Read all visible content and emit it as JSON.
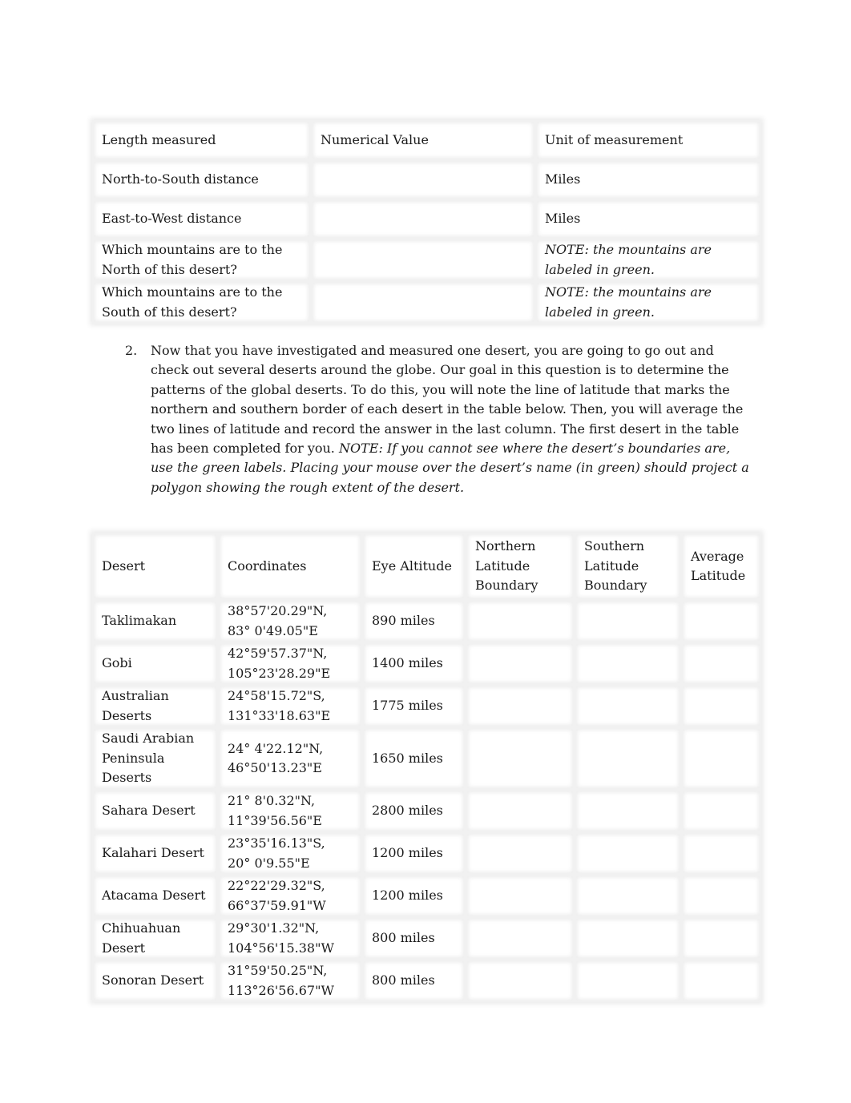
{
  "table1": {
    "headers": [
      "Length measured",
      "Numerical Value",
      "Unit of measurement"
    ],
    "rows": [
      {
        "label": "North-to-South distance",
        "value": "",
        "unit": "Miles",
        "unit_italic": false
      },
      {
        "label": "East-to-West distance",
        "value": "",
        "unit": "Miles",
        "unit_italic": false
      },
      {
        "label": "Which mountains are to the North of this desert?",
        "value": "",
        "unit": "NOTE: the mountains are labeled in green.",
        "unit_italic": true
      },
      {
        "label": "Which mountains are to the South of this desert?",
        "value": "",
        "unit": "NOTE: the mountains are labeled in green.",
        "unit_italic": true
      }
    ]
  },
  "question2": {
    "number": "2.",
    "text": "Now that you have investigated and measured one desert, you are going to go out and check out several deserts around the globe.  Our goal in this question is to determine the patterns of the global deserts.  To do this, you will note the line of latitude that marks the northern and southern border of each desert in the table below.   Then, you will average the two lines of latitude and record the answer in the last column.  The first desert in the table has been completed for you.  ",
    "note": "NOTE: If you cannot see where the desert’s boundaries are, use the green labels.  Placing your mouse over the desert’s name (in green) should project a polygon showing the rough extent of the desert."
  },
  "table2": {
    "headers": [
      "Desert",
      "Coordinates",
      "Eye Altitude",
      "Northern Latitude Boundary",
      "Southern Latitude Boundary",
      "Average Latitude"
    ],
    "rows": [
      {
        "desert": "Taklimakan",
        "lat": "38°57'20.29\"N,",
        "lon": "83° 0'49.05\"E",
        "altitude": "890 miles",
        "north": "",
        "south": "",
        "average": ""
      },
      {
        "desert": "Gobi",
        "lat": "42°59'57.37\"N,",
        "lon": "105°23'28.29\"E",
        "altitude": "1400 miles",
        "north": "",
        "south": "",
        "average": ""
      },
      {
        "desert": "Australian Deserts",
        "lat": "24°58'15.72\"S,",
        "lon": "131°33'18.63\"E",
        "altitude": "1775 miles",
        "north": "",
        "south": "",
        "average": ""
      },
      {
        "desert": "Saudi Arabian Peninsula Deserts",
        "lat": "24° 4'22.12\"N,",
        "lon": "46°50'13.23\"E",
        "altitude": "1650 miles",
        "north": "",
        "south": "",
        "average": ""
      },
      {
        "desert": "Sahara Desert",
        "lat": "21° 8'0.32\"N,",
        "lon": "11°39'56.56\"E",
        "altitude": "2800 miles",
        "north": "",
        "south": "",
        "average": ""
      },
      {
        "desert": "Kalahari Desert",
        "lat": "23°35'16.13\"S,",
        "lon": "20° 0'9.55\"E",
        "altitude": "1200 miles",
        "north": "",
        "south": "",
        "average": ""
      },
      {
        "desert": "Atacama Desert",
        "lat": "22°22'29.32\"S,",
        "lon": "66°37'59.91\"W",
        "altitude": "1200 miles",
        "north": "",
        "south": "",
        "average": ""
      },
      {
        "desert": "Chihuahuan Desert",
        "lat": "29°30'1.32\"N,",
        "lon": "104°56'15.38\"W",
        "altitude": "800 miles",
        "north": "",
        "south": "",
        "average": ""
      },
      {
        "desert": "Sonoran Desert",
        "lat": "31°59'50.25\"N,",
        "lon": "113°26'56.67\"W",
        "altitude": "800 miles",
        "north": "",
        "south": "",
        "average": ""
      }
    ]
  }
}
